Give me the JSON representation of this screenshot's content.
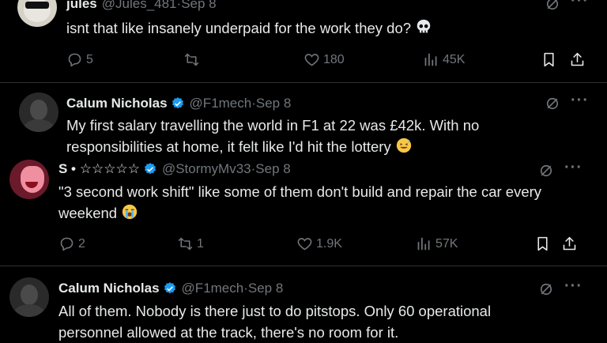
{
  "tweets": [
    {
      "name": "jules",
      "handle": "@Jules_481",
      "sep": " · ",
      "date": "Sep 8",
      "text": "isnt that like insanely underpaid for the work they do?",
      "replies": "5",
      "retweets": "",
      "likes": "180",
      "views": "45K"
    },
    {
      "name": "Calum Nicholas",
      "handle": "@F1mech",
      "sep": " · ",
      "date": "Sep 8",
      "text_line1": "My first salary travelling the world in F1 at 22 was £42k. With no",
      "text_line2": "responsibilities at home, it felt like I'd hit the lottery"
    },
    {
      "name": "S • ☆☆☆☆☆",
      "handle": "@StormyMv33",
      "sep": " · ",
      "date": "Sep 8",
      "text_line1": "\"3 second work shift\" like some of them don't build and repair the car every",
      "text_line2": "weekend",
      "replies": "2",
      "retweets": "1",
      "likes": "1.9K",
      "views": "57K"
    },
    {
      "name": "Calum Nicholas",
      "handle": "@F1mech",
      "sep": " · ",
      "date": "Sep 8",
      "text_line1": "All of them. Nobody is there just to do pitstops. Only 60 operational",
      "text_line2": "personnel allowed at the track, there's no room for it."
    }
  ],
  "more_label": "···",
  "colors": {
    "accent": "#1d9bf0",
    "muted": "#71767b",
    "text": "#e7e9ea",
    "bg": "#000000"
  },
  "icons": [
    "skull-emoji",
    "sweat-smile-emoji",
    "loudly-crying-emoji",
    "reply-icon",
    "retweet-icon",
    "like-icon",
    "views-icon",
    "bookmark-icon",
    "share-icon",
    "grok-icon",
    "more-icon",
    "verified-badge-icon"
  ]
}
